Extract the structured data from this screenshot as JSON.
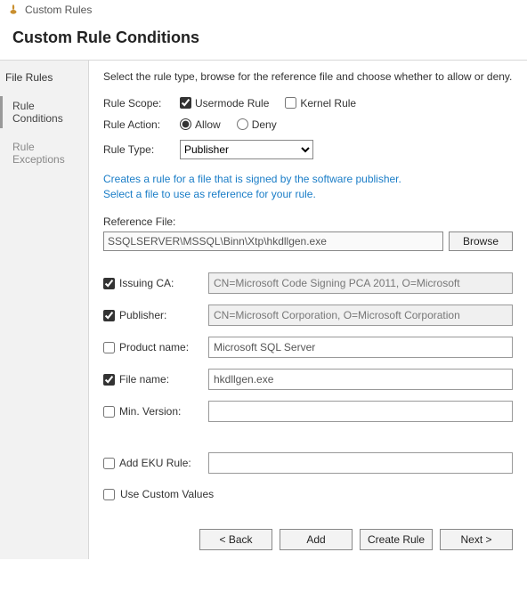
{
  "window": {
    "title": "Custom Rules"
  },
  "heading": "Custom Rule Conditions",
  "sidebar": {
    "section": "File Rules",
    "items": [
      {
        "label": "Rule Conditions",
        "active": true
      },
      {
        "label": "Rule Exceptions",
        "active": false
      }
    ]
  },
  "intro": "Select the rule type, browse for the reference file and choose whether to allow or deny.",
  "scope": {
    "label": "Rule Scope:",
    "usermode": {
      "label": "Usermode Rule",
      "checked": true
    },
    "kernel": {
      "label": "Kernel Rule",
      "checked": false
    }
  },
  "action": {
    "label": "Rule Action:",
    "allow": {
      "label": "Allow",
      "checked": true
    },
    "deny": {
      "label": "Deny",
      "checked": false
    }
  },
  "type": {
    "label": "Rule Type:",
    "selected": "Publisher"
  },
  "hint": "Creates a rule for a file that is signed by the software publisher.\nSelect a file to use as reference for your rule.",
  "reference": {
    "label": "Reference File:",
    "value": "SSQLSERVER\\MSSQL\\Binn\\Xtp\\hkdllgen.exe",
    "browse": "Browse"
  },
  "fields": {
    "issuing_ca": {
      "label": "Issuing CA:",
      "checked": true,
      "value": "CN=Microsoft Code Signing PCA 2011, O=Microsoft"
    },
    "publisher": {
      "label": "Publisher:",
      "checked": true,
      "value": "CN=Microsoft Corporation, O=Microsoft Corporation"
    },
    "product_name": {
      "label": "Product name:",
      "checked": false,
      "value": "Microsoft SQL Server"
    },
    "file_name": {
      "label": "File name:",
      "checked": true,
      "value": "hkdllgen.exe"
    },
    "min_version": {
      "label": "Min. Version:",
      "checked": false,
      "value": ""
    },
    "add_eku": {
      "label": "Add EKU Rule:",
      "checked": false,
      "value": ""
    },
    "use_custom": {
      "label": "Use Custom Values",
      "checked": false
    }
  },
  "footer": {
    "back": "< Back",
    "add": "Add",
    "create": "Create Rule",
    "next": "Next >"
  }
}
